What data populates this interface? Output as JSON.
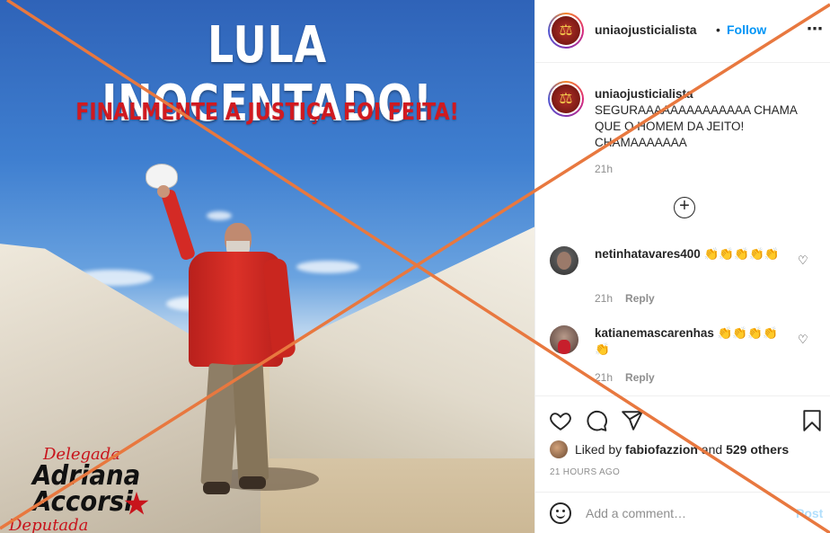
{
  "image": {
    "headline": "LULA INOCENTADO!",
    "subheadline": "FINALMENTE A JUSTIÇA FOI FEITA!",
    "logo": {
      "top": "Delegada",
      "name_line1": "Adriana",
      "name_line2": "Accorsi",
      "bottom": "Deputada Estadual"
    }
  },
  "header": {
    "username": "uniaojusticialista",
    "separator": "•",
    "follow_label": "Follow",
    "more_icon": "more-horizontal-icon"
  },
  "caption": {
    "username": "uniaojusticialista",
    "text": "SEGURAAAAAAAAAAAAAA CHAMA QUE O HOMEM DA JEITO! CHAMAAAAAAA",
    "time": "21h"
  },
  "load_more_icon": "plus-circle-icon",
  "comments": [
    {
      "username": "netinhatavares400",
      "text": "👏👏👏👏👏",
      "time": "21h",
      "reply_label": "Reply"
    },
    {
      "username": "katianemascarenhas",
      "text": "👏👏👏👏👏",
      "time": "21h",
      "reply_label": "Reply"
    }
  ],
  "actions": {
    "liked_by_prefix": "Liked by",
    "liked_by_user": "fabiofazzion",
    "liked_by_and": "and",
    "liked_by_others": "529 others",
    "time_ago": "21 HOURS AGO"
  },
  "comment_input": {
    "placeholder": "Add a comment…",
    "post_label": "Post"
  },
  "colors": {
    "follow_blue": "#0095f6",
    "post_disabled": "#b2dffc",
    "cross_overlay": "#e8783f",
    "headline_red": "#d01a20"
  }
}
